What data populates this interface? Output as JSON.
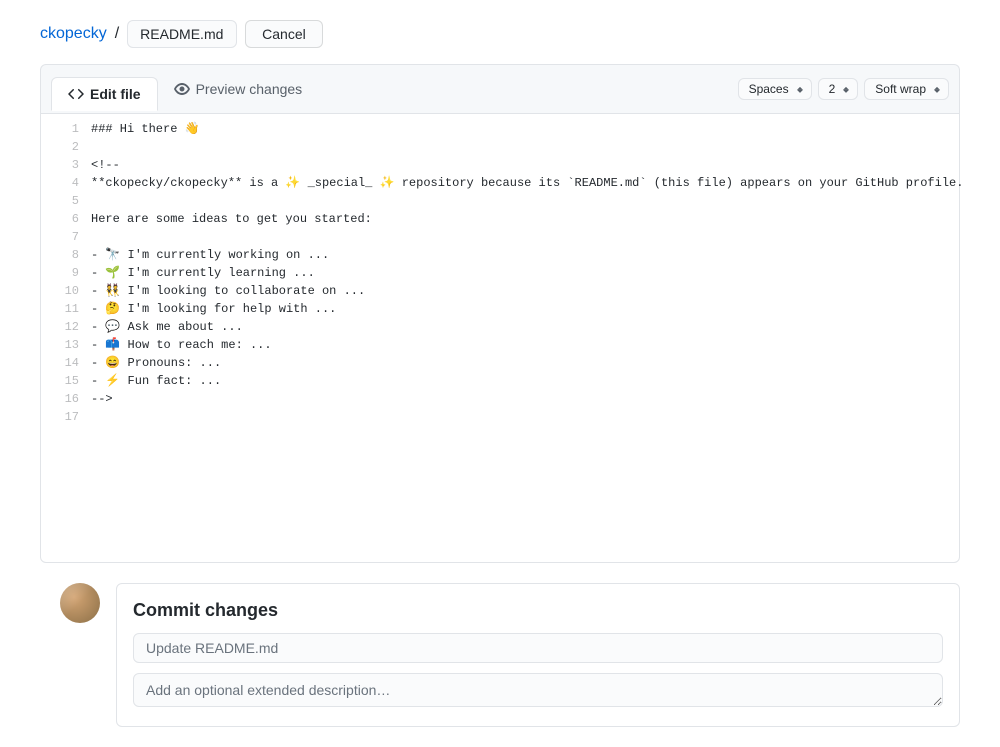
{
  "header": {
    "repo_name": "ckopecky",
    "separator": "/",
    "filename": "README.md",
    "cancel_label": "Cancel"
  },
  "tabs": {
    "edit_label": "Edit file",
    "preview_label": "Preview changes"
  },
  "toolbar": {
    "indent_mode": "Spaces",
    "indent_size": "2",
    "wrap_mode": "Soft wrap"
  },
  "editor": {
    "lines": [
      "### Hi there 👋",
      "",
      "<!--",
      "**ckopecky/ckopecky** is a ✨ _special_ ✨ repository because its `README.md` (this file) appears on your GitHub profile.",
      "",
      "Here are some ideas to get you started:",
      "",
      "- 🔭 I'm currently working on ...",
      "- 🌱 I'm currently learning ...",
      "- 👯 I'm looking to collaborate on ...",
      "- 🤔 I'm looking for help with ...",
      "- 💬 Ask me about ...",
      "- 📫 How to reach me: ...",
      "- 😄 Pronouns: ...",
      "- ⚡ Fun fact: ...",
      "-->",
      ""
    ]
  },
  "commit": {
    "heading": "Commit changes",
    "summary_placeholder": "Update README.md",
    "description_placeholder": "Add an optional extended description…"
  }
}
